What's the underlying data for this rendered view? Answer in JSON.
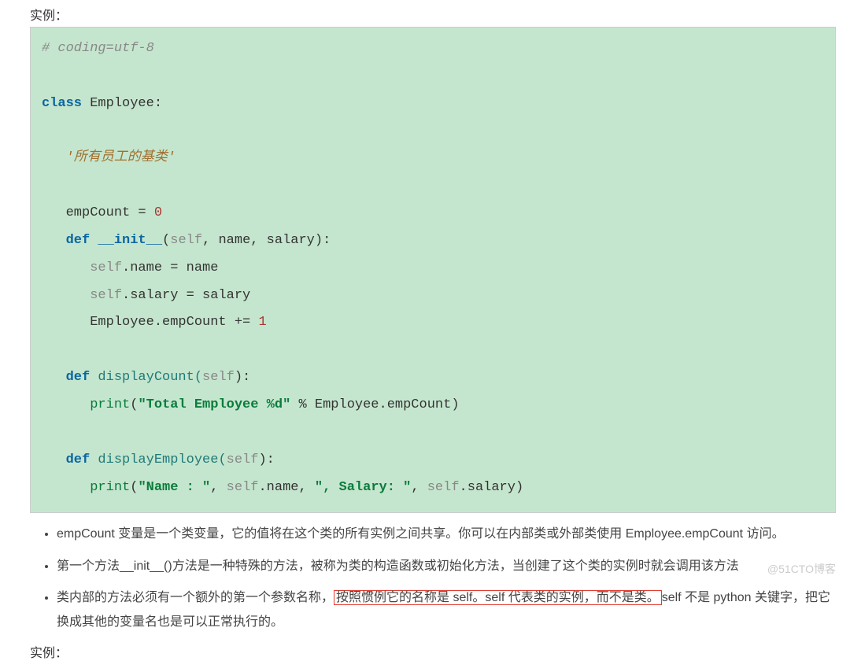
{
  "heading_top": "实例：",
  "code": {
    "l01_comment": "# coding=utf-8",
    "l02_blank": "",
    "l03_class_kw": "class",
    "l03_class_name": " Employee:",
    "l04_blank": "",
    "l05_docstring": "   '所有员工的基类'",
    "l06_blank": "",
    "l07": "   empCount = ",
    "l07_num": "0",
    "l08_def": "   def",
    "l08_init": " __init__",
    "l08_open": "(",
    "l08_self": "self",
    "l08_rest": ", name, salary):",
    "l09_pre": "      ",
    "l09_self": "self",
    "l09_rest": ".name = name",
    "l10_pre": "      ",
    "l10_self": "self",
    "l10_rest": ".salary = salary",
    "l11": "      Employee.empCount += ",
    "l11_num": "1",
    "l12_blank": "",
    "l13_def": "   def",
    "l13_fn": " displayCount(",
    "l13_self": "self",
    "l13_close": "):",
    "l14_pre": "      ",
    "l14_print": "print",
    "l14_open": "(",
    "l14_str": "\"Total Employee %d\"",
    "l14_rest": " % Employee.empCount)",
    "l15_blank": "",
    "l16_def": "   def",
    "l16_fn": " displayEmployee(",
    "l16_self": "self",
    "l16_close": "):",
    "l17_pre": "      ",
    "l17_print": "print",
    "l17_open": "(",
    "l17_s1": "\"Name : \"",
    "l17_c1": ", ",
    "l17_self1": "self",
    "l17_p1": ".name, ",
    "l17_s2": "\", Salary: \"",
    "l17_c2": ", ",
    "l17_self2": "self",
    "l17_p2": ".salary)"
  },
  "bullets": {
    "b1": "empCount 变量是一个类变量，它的值将在这个类的所有实例之间共享。你可以在内部类或外部类使用 Employee.empCount 访问。",
    "b2": "第一个方法__init__()方法是一种特殊的方法，被称为类的构造函数或初始化方法，当创建了这个类的实例时就会调用该方法",
    "b3_pre": "类内部的方法必须有一个额外的第一个参数名称，",
    "b3_hl": "按照惯例它的名称是 self。self 代表类的实例，而不是类。",
    "b3_post": "self 不是 python 关键字，把它换成其他的变量名也是可以正常执行的。"
  },
  "heading_bottom": "实例：",
  "watermark": "@51CTO博客"
}
